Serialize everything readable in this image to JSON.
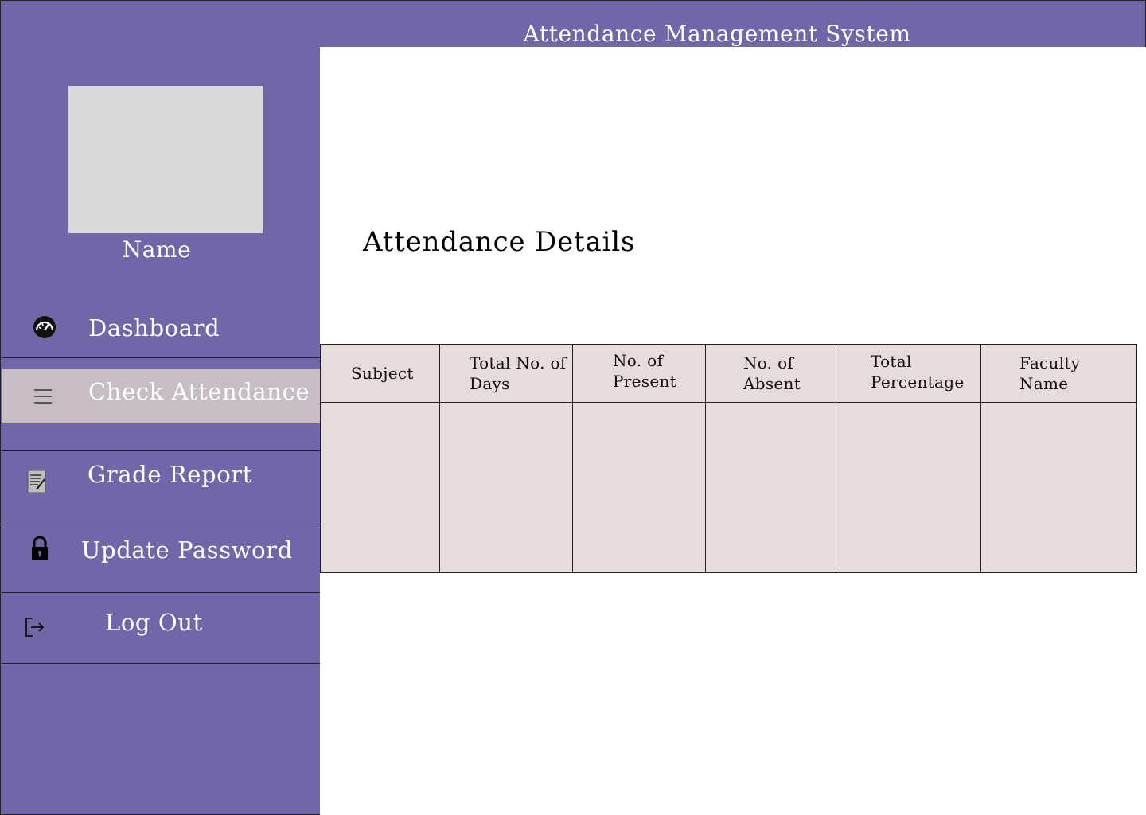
{
  "app": {
    "title": "Attendance Management System"
  },
  "sidebar": {
    "user_name": "Name",
    "items": [
      {
        "label": "Dashboard",
        "icon": "dashboard-gauge-icon",
        "active": false
      },
      {
        "label": "Check Attendance",
        "icon": "menu-lines-icon",
        "active": true
      },
      {
        "label": "Grade Report",
        "icon": "report-document-icon",
        "active": false
      },
      {
        "label": "Update Password",
        "icon": "lock-icon",
        "active": false
      },
      {
        "label": "Log Out",
        "icon": "logout-icon",
        "active": false
      }
    ]
  },
  "main": {
    "heading": "Attendance Details",
    "table": {
      "columns": [
        "Subject",
        "Total No. of Days",
        "No. of Present",
        "No. of Absent",
        "Total Percentage",
        "Faculty Name"
      ],
      "rows": []
    }
  },
  "colors": {
    "sidebar_bg": "#7066a8",
    "active_item_bg": "#c6bec4",
    "table_bg": "#e6dcdc",
    "avatar_bg": "#d9d9d9"
  }
}
